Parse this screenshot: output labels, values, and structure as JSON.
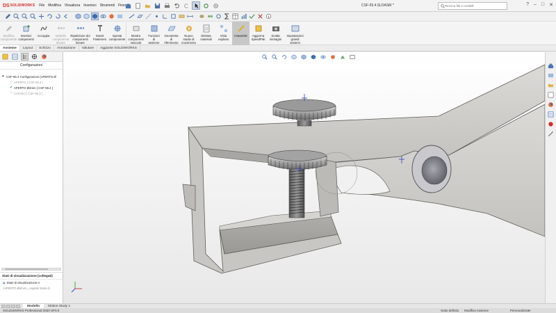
{
  "titlebar": {
    "logo_ds": "DS",
    "logo_text": "SOLIDWORKS",
    "menu": [
      "File",
      "Modifica",
      "Visualizza",
      "Inserisci",
      "Strumenti",
      "Finestra"
    ],
    "document_title": "CSF-55.4.SLDASM *",
    "search_placeholder": "Ricerca file e modelli",
    "window_controls": [
      "?",
      "–",
      "□",
      "✕"
    ]
  },
  "ribbon": {
    "buttons": [
      {
        "label": "Modifica\ncomponente",
        "disabled": true,
        "icon": "edit-component-icon"
      },
      {
        "label": "Inserisci\ncomponenti",
        "disabled": false,
        "icon": "insert-components-icon"
      },
      {
        "label": "Accoppia",
        "disabled": false,
        "icon": "mate-icon"
      },
      {
        "label": "Modello\ncomponente\nlineare",
        "disabled": true,
        "icon": "linear-pattern-icon"
      },
      {
        "label": "Ripetizione dei\ncomponenti\nlineare",
        "disabled": false,
        "icon": "linear-component-pattern-icon"
      },
      {
        "label": "Smart\nFasteners",
        "disabled": false,
        "icon": "smart-fasteners-icon"
      },
      {
        "label": "Sposta\ncomponente",
        "disabled": false,
        "icon": "move-component-icon"
      },
      {
        "label": "Mostra\ncomponenti\nnascosti",
        "disabled": false,
        "icon": "show-hidden-icon"
      },
      {
        "label": "Funzioni\ndi\nassieme",
        "disabled": false,
        "icon": "assembly-features-icon"
      },
      {
        "label": "Geometria\ndi\nriferimento",
        "disabled": false,
        "icon": "reference-geometry-icon"
      },
      {
        "label": "Nuovo\nstudio di\nmovimento",
        "disabled": false,
        "icon": "motion-study-icon"
      },
      {
        "label": "Distinta\nmateriali",
        "disabled": false,
        "icon": "bom-icon"
      },
      {
        "label": "Vista\nesplosa",
        "disabled": false,
        "icon": "exploded-view-icon"
      },
      {
        "label": "Instant3D",
        "disabled": false,
        "active": true,
        "icon": "instant3d-icon"
      },
      {
        "label": "Aggiorna\nSpeedPak",
        "disabled": false,
        "icon": "speedpak-icon"
      },
      {
        "label": "Scatta\nimmagini",
        "disabled": false,
        "icon": "snapshot-icon"
      },
      {
        "label": "Impostazioni\ngrandi\nassiemi",
        "disabled": false,
        "icon": "large-assembly-icon"
      }
    ]
  },
  "tabs": [
    "Assieme",
    "Layout",
    "Schizzo",
    "Annotazione",
    "Valutare",
    "Aggiunte SOLIDWORKS"
  ],
  "left_panel": {
    "header": "Configurazioni",
    "root": "CSF-55.4 Configurazioni  (APERTO Ø",
    "configs": [
      {
        "label": "APERTO [ CSF-55.4 ]",
        "state": "inactive"
      },
      {
        "label": "APERTO Ø4mm [ CSF-55.4 ]",
        "state": "current"
      },
      {
        "label": "CHIUSO [ CSF-55.4 ]",
        "state": "inactive"
      }
    ],
    "display_states_header": "Stati di visualizzazione (collegati)",
    "display_states": [
      {
        "label": "Stato di visualizzazione-4",
        "muted": false
      },
      {
        "label": "<APERTO Ø4mm>_Aspetto Stato di",
        "muted": true
      }
    ]
  },
  "model_tabs": [
    "Modello",
    "Motion Study 1"
  ],
  "statusbar": {
    "product": "SOLIDWORKS Professional 2020 SP3.0",
    "definition": "Sotto definito",
    "mode": "Modifica Assieme",
    "custom": "Personalizzate"
  },
  "colors": {
    "accent": "#d62b2b",
    "selection": "#c9d4e6",
    "part_gray": "#d2d0cc"
  }
}
